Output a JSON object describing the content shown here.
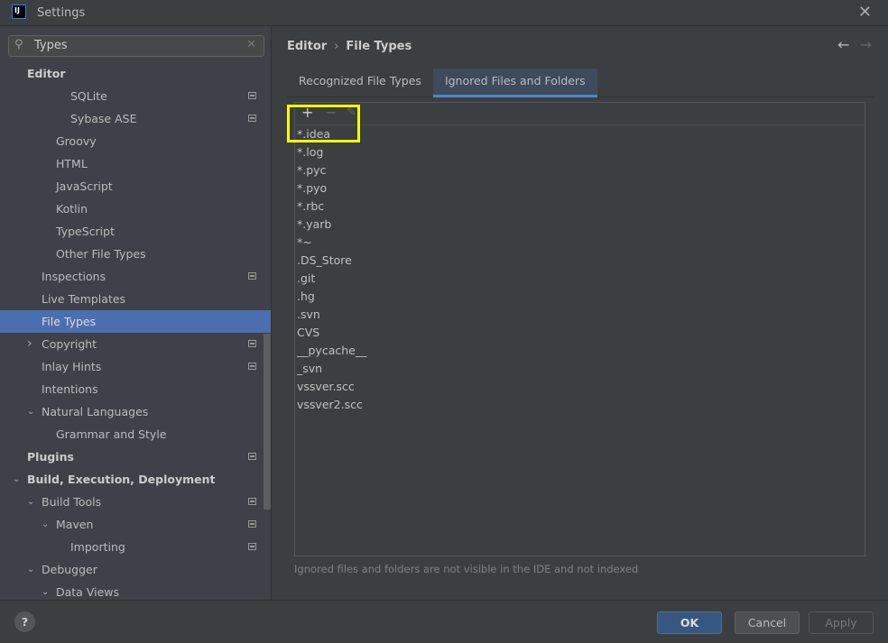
{
  "window": {
    "title": "Settings",
    "logo": "IJ"
  },
  "search": {
    "value": "Types"
  },
  "sidebar": {
    "items": [
      {
        "label": "Editor",
        "level": 0,
        "bold": true,
        "chevron": "",
        "gear": false
      },
      {
        "label": "SQLite",
        "level": 3,
        "chevron": "",
        "gear": true
      },
      {
        "label": "Sybase ASE",
        "level": 3,
        "chevron": "",
        "gear": true
      },
      {
        "label": "Groovy",
        "level": 2,
        "chevron": "",
        "gear": false
      },
      {
        "label": "HTML",
        "level": 2,
        "chevron": "",
        "gear": false
      },
      {
        "label": "JavaScript",
        "level": 2,
        "chevron": "",
        "gear": false
      },
      {
        "label": "Kotlin",
        "level": 2,
        "chevron": "",
        "gear": false
      },
      {
        "label": "TypeScript",
        "level": 2,
        "chevron": "",
        "gear": false
      },
      {
        "label": "Other File Types",
        "level": 2,
        "chevron": "",
        "gear": false
      },
      {
        "label": "Inspections",
        "level": 1,
        "chevron": "",
        "gear": true
      },
      {
        "label": "Live Templates",
        "level": 1,
        "chevron": "",
        "gear": false
      },
      {
        "label": "File Types",
        "level": 1,
        "chevron": "",
        "gear": false,
        "selected": true
      },
      {
        "label": "Copyright",
        "level": 1,
        "chevron": "right",
        "gear": true
      },
      {
        "label": "Inlay Hints",
        "level": 1,
        "chevron": "",
        "gear": true
      },
      {
        "label": "Intentions",
        "level": 1,
        "chevron": "",
        "gear": false
      },
      {
        "label": "Natural Languages",
        "level": 1,
        "chevron": "down",
        "gear": false
      },
      {
        "label": "Grammar and Style",
        "level": 2,
        "chevron": "",
        "gear": false
      },
      {
        "label": "Plugins",
        "level": 0,
        "bold": true,
        "chevron": "",
        "gear": true
      },
      {
        "label": "Build, Execution, Deployment",
        "level": 0,
        "bold": true,
        "chevron": "down",
        "gear": false
      },
      {
        "label": "Build Tools",
        "level": 1,
        "chevron": "down",
        "gear": true
      },
      {
        "label": "Maven",
        "level": 2,
        "chevron": "down",
        "gear": true
      },
      {
        "label": "Importing",
        "level": 3,
        "chevron": "",
        "gear": true
      },
      {
        "label": "Debugger",
        "level": 1,
        "chevron": "down",
        "gear": false
      },
      {
        "label": "Data Views",
        "level": 2,
        "chevron": "down",
        "gear": false
      }
    ]
  },
  "breadcrumb": {
    "parent": "Editor",
    "current": "File Types"
  },
  "tabs": [
    {
      "label": "Recognized File Types"
    },
    {
      "label": "Ignored Files and Folders",
      "active": true
    }
  ],
  "ignored": [
    "*.idea",
    "*.log",
    "*.pyc",
    "*.pyo",
    "*.rbc",
    "*.yarb",
    "*~",
    ".DS_Store",
    ".git",
    ".hg",
    ".svn",
    "CVS",
    "__pycache__",
    "_svn",
    "vssver.scc",
    "vssver2.scc"
  ],
  "hint": "Ignored files and folders are not visible in the IDE and not indexed",
  "footer": {
    "ok": "OK",
    "cancel": "Cancel",
    "apply": "Apply",
    "help": "?"
  },
  "colors": {
    "selection": "#4b6eaf",
    "ok": "#365880",
    "highlight": "#ffff00"
  }
}
